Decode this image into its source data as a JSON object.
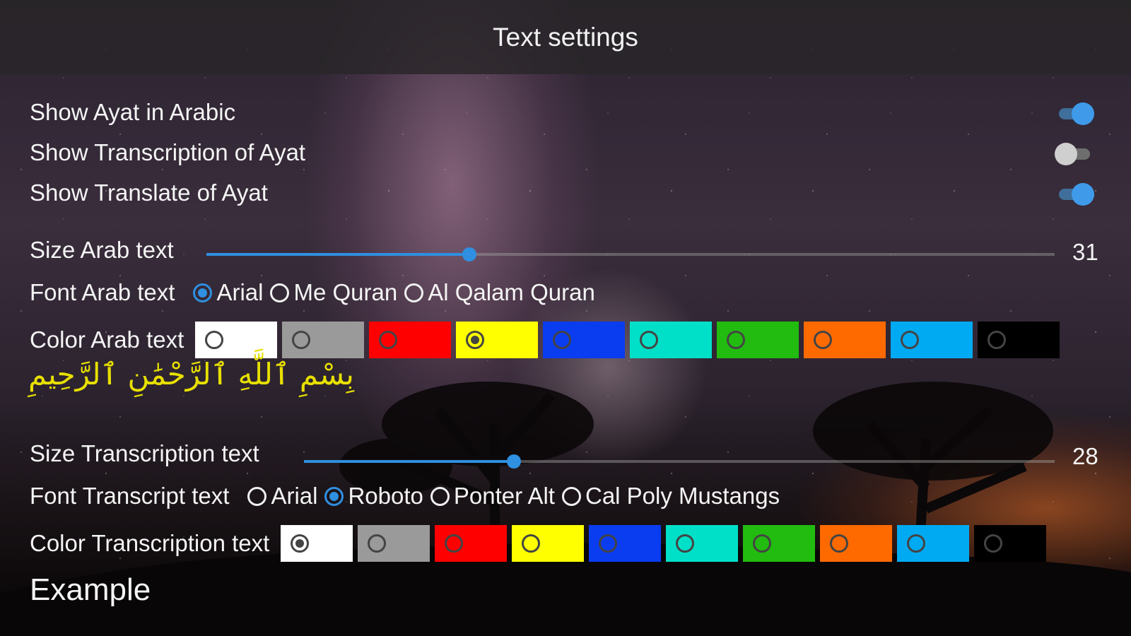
{
  "header": {
    "title": "Text settings"
  },
  "toggles": [
    {
      "label": "Show Ayat in Arabic",
      "on": true
    },
    {
      "label": "Show Transcription of Ayat",
      "on": false
    },
    {
      "label": "Show Translate of Ayat",
      "on": true
    }
  ],
  "arab": {
    "size_label": "Size Arab text",
    "size_value": "31",
    "size_fraction": 0.31,
    "font_label": "Font Arab text",
    "fonts": [
      {
        "label": "Arial",
        "checked": true
      },
      {
        "label": "Me Quran",
        "checked": false
      },
      {
        "label": "Al Qalam Quran",
        "checked": false
      }
    ],
    "color_label": "Color Arab text",
    "selected_color": "#ffff00",
    "sample": "بِسْمِ ٱللَّهِ ٱلرَّحْمَٰنِ ٱلرَّحِيمِ"
  },
  "transcription": {
    "size_label": "Size Transcription text",
    "size_value": "28",
    "size_fraction": 0.28,
    "font_label": "Font Transcript text",
    "fonts": [
      {
        "label": "Arial",
        "checked": false
      },
      {
        "label": "Roboto",
        "checked": true
      },
      {
        "label": "Ponter Alt",
        "checked": false
      },
      {
        "label": "Cal Poly Mustangs",
        "checked": false
      }
    ],
    "color_label": "Color Transcription text",
    "selected_color": "#ffffff",
    "example": "Example"
  },
  "palette": [
    "#ffffff",
    "#9a9a9a",
    "#ff0000",
    "#ffff00",
    "#0a3cf0",
    "#00e0c8",
    "#22bb10",
    "#ff6a00",
    "#00aaf2",
    "#000000"
  ],
  "colors": {
    "accent": "#2f8fe0",
    "arabic_sample": "#e8e000"
  }
}
